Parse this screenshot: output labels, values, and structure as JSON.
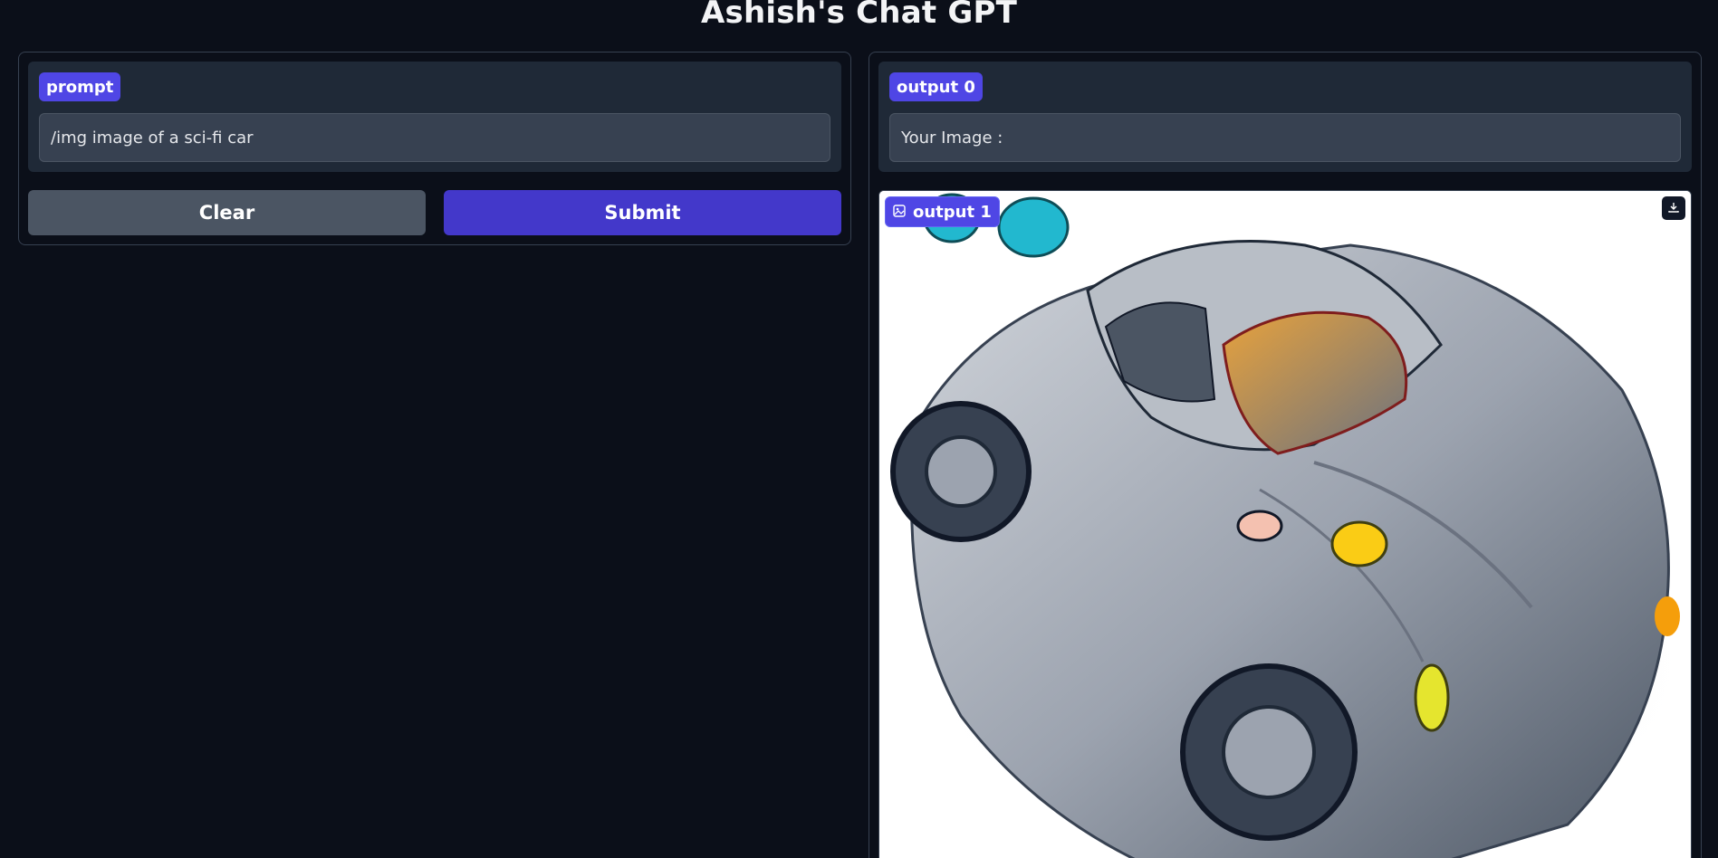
{
  "app": {
    "title": "Ashish's Chat GPT"
  },
  "input": {
    "label": "prompt",
    "value": "/img image of a sci-fi car"
  },
  "buttons": {
    "clear_label": "Clear",
    "submit_label": "Submit"
  },
  "outputs": {
    "text_label": "output 0",
    "text_value": "Your Image :",
    "image_label": "output 1"
  },
  "icons": {
    "image": "image-icon",
    "download": "download-icon"
  },
  "colors": {
    "background": "#0b0f19",
    "panel": "#1f2937",
    "field": "#374151",
    "accent": "#4f46e5",
    "submit": "#4338ca",
    "clear": "#4b5563"
  }
}
